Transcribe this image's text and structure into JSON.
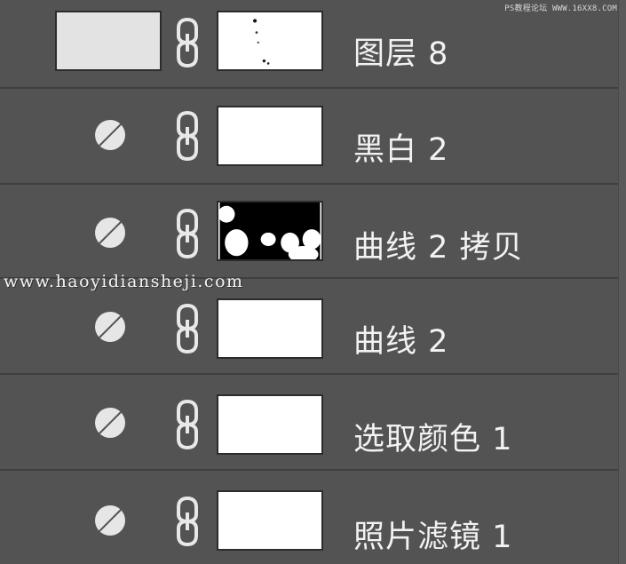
{
  "watermark_top": "PS教程论坛 WWW.16XX8.COM",
  "watermark_url": "www.haoyidiansheji.com",
  "layers": [
    {
      "name": "图层 8",
      "type": "pixel",
      "icon": "image-thumbnail",
      "mask": "white-with-specks"
    },
    {
      "name": "黑白 2",
      "type": "adjustment",
      "icon": "adjustment-circle-icon",
      "mask": "white"
    },
    {
      "name": "曲线 2 拷贝",
      "type": "adjustment",
      "icon": "adjustment-circle-icon",
      "mask": "black-with-white-blobs"
    },
    {
      "name": "曲线 2",
      "type": "adjustment",
      "icon": "adjustment-circle-icon",
      "mask": "white"
    },
    {
      "name": "选取颜色 1",
      "type": "adjustment",
      "icon": "adjustment-circle-icon",
      "mask": "white"
    },
    {
      "name": "照片滤镜 1",
      "type": "adjustment",
      "icon": "adjustment-circle-icon",
      "mask": "white"
    }
  ],
  "colors": {
    "panel_bg": "#535353",
    "divider": "#3f3f3f",
    "text": "#f2f2f2",
    "mask_black": "#000000",
    "mask_white": "#ffffff"
  }
}
